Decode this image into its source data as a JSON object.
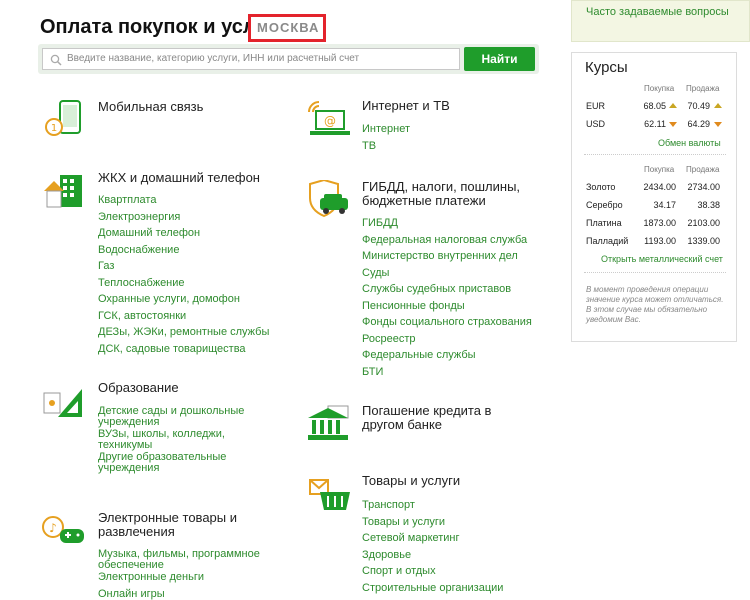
{
  "header": {
    "title": "Оплата покупок и услуг",
    "city": "МОСКВА"
  },
  "search": {
    "placeholder": "Введите название, категорию услуги, ИНН или расчетный счет",
    "button": "Найти"
  },
  "categories": {
    "mobile": {
      "title": "Мобильная связь",
      "links": []
    },
    "internet": {
      "title": "Интернет и ТВ",
      "links": [
        "Интернет",
        "ТВ"
      ]
    },
    "housing": {
      "title": "ЖКХ и домашний телефон",
      "links": [
        "Квартплата",
        "Электроэнергия",
        "Домашний телефон",
        "Водоснабжение",
        "Газ",
        "Теплоснабжение",
        "Охранные услуги, домофон",
        "ГСК, автостоянки",
        "ДЕЗы, ЖЭКи, ремонтные службы",
        "ДСК, садовые товарищества"
      ]
    },
    "gibdd": {
      "title": "ГИБДД, налоги, пошлины, бюджетные платежи",
      "links": [
        "ГИБДД",
        "Федеральная налоговая служба",
        "Министерство внутренних дел",
        "Суды",
        "Службы судебных приставов",
        "Пенсионные фонды",
        "Фонды социального страхования",
        "Росреестр",
        "Федеральные службы",
        "БТИ"
      ]
    },
    "education": {
      "title": "Образование",
      "links": [
        "Детские сады и дошкольные учреждения",
        "ВУЗы, школы, колледжи, техникумы",
        "Другие образовательные учреждения"
      ]
    },
    "credit": {
      "title": "Погашение кредита в другом банке",
      "links": []
    },
    "electronics": {
      "title": "Электронные товары и развлечения",
      "links": [
        "Музыка, фильмы, программное обеспечение",
        "Электронные деньги",
        "Онлайн игры"
      ]
    },
    "goods": {
      "title": "Товары и услуги",
      "links": [
        "Транспорт",
        "Товары и услуги",
        "Сетевой маркетинг",
        "Здоровье",
        "Спорт и отдых",
        "Строительные организации"
      ]
    }
  },
  "sidebar": {
    "faq": "Часто задаваемые вопросы",
    "rates": {
      "title": "Курсы",
      "buy_label": "Покупка",
      "sell_label": "Продажа",
      "currencies": [
        {
          "name": "EUR",
          "buy": "68.05",
          "buy_trend": "up",
          "sell": "70.49",
          "sell_trend": "up"
        },
        {
          "name": "USD",
          "buy": "62.11",
          "buy_trend": "down",
          "sell": "64.29",
          "sell_trend": "down"
        }
      ],
      "currency_link": "Обмен валюты",
      "metals": [
        {
          "name": "Золото",
          "buy": "2434.00",
          "sell": "2734.00"
        },
        {
          "name": "Серебро",
          "buy": "34.17",
          "sell": "38.38"
        },
        {
          "name": "Платина",
          "buy": "1873.00",
          "sell": "2103.00"
        },
        {
          "name": "Палладий",
          "buy": "1193.00",
          "sell": "1339.00"
        }
      ],
      "metals_link": "Открыть металлический счет",
      "note": "В момент проведения операции значение курса может отличаться. В этом случае мы обязательно уведомим Вас."
    },
    "colors": {
      "accent": "#1f9d2b",
      "link": "#2e8b2e",
      "highlight": "#e3232c",
      "arrow_up": "#c9a623",
      "arrow_down": "#e08a1e"
    }
  }
}
